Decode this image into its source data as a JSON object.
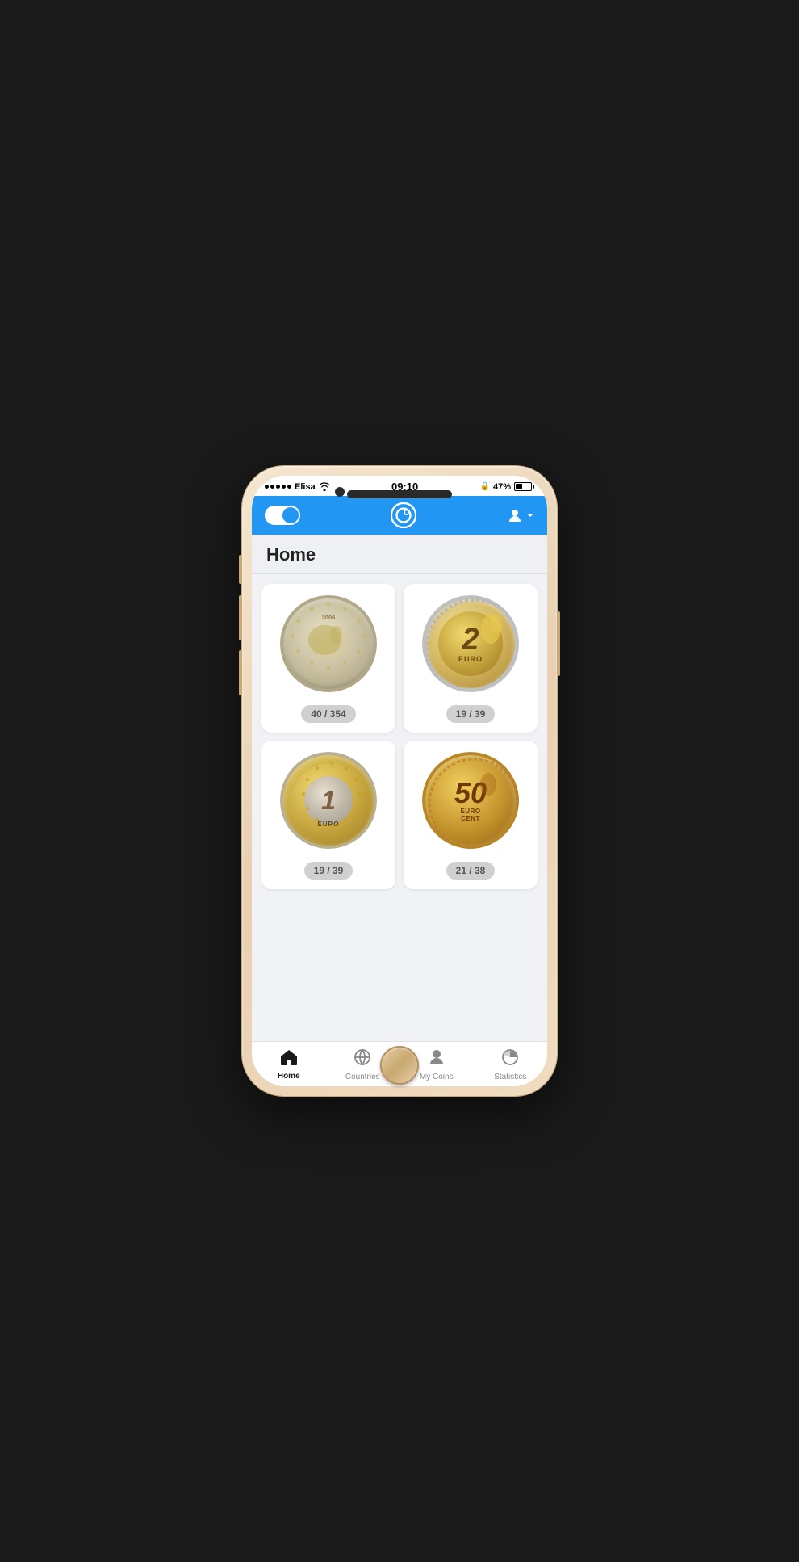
{
  "phone": {
    "status_bar": {
      "carrier": "Elisa",
      "wifi": "wifi",
      "time": "09:10",
      "lock": "🔒",
      "battery_percent": "47%"
    },
    "header": {
      "logo_alt": "CoinTracker Logo"
    },
    "page_title": "Home",
    "coins": [
      {
        "id": "coin-eu-map",
        "type": "2euro-back",
        "badge": "40 / 354"
      },
      {
        "id": "coin-2euro-front",
        "type": "2euro-front",
        "badge": "19 / 39"
      },
      {
        "id": "coin-1euro",
        "type": "1euro",
        "badge": "19 / 39"
      },
      {
        "id": "coin-50cent",
        "type": "50cent",
        "badge": "21 / 38"
      }
    ],
    "bottom_nav": [
      {
        "id": "home",
        "label": "Home",
        "icon": "🏠",
        "active": true
      },
      {
        "id": "countries",
        "label": "Countries",
        "icon": "🌍",
        "active": false
      },
      {
        "id": "mycoins",
        "label": "My Coins",
        "icon": "👤",
        "active": false
      },
      {
        "id": "statistics",
        "label": "Statistics",
        "icon": "📊",
        "active": false
      }
    ]
  }
}
